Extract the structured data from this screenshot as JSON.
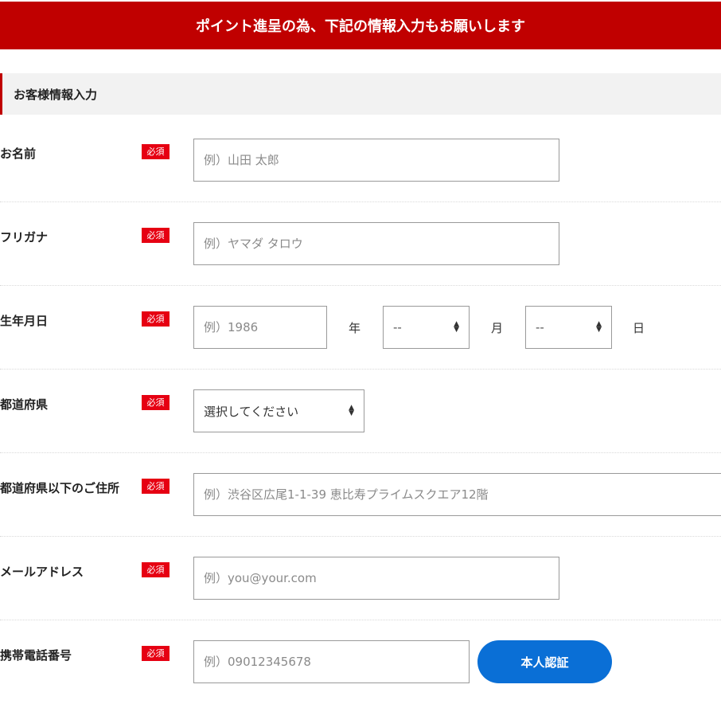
{
  "banner": {
    "text": "ポイント進呈の為、下記の情報入力もお願いします"
  },
  "section": {
    "title": "お客様情報入力"
  },
  "required_label": "必須",
  "fields": {
    "name": {
      "label": "お名前",
      "placeholder": "例）山田 太郎"
    },
    "furigana": {
      "label": "フリガナ",
      "placeholder": "例）ヤマダ タロウ"
    },
    "birthdate": {
      "label": "生年月日",
      "year_placeholder": "例）1986",
      "year_unit": "年",
      "month_value": "--",
      "month_unit": "月",
      "day_value": "--",
      "day_unit": "日"
    },
    "prefecture": {
      "label": "都道府県",
      "value": "選択してください"
    },
    "address": {
      "label": "都道府県以下のご住所",
      "placeholder": "例）渋谷区広尾1-1-39 恵比寿プライムスクエア12階"
    },
    "email": {
      "label": "メールアドレス",
      "placeholder": "例）you@your.com"
    },
    "phone": {
      "label": "携帯電話番号",
      "placeholder": "例）09012345678",
      "verify_button": "本人認証"
    }
  },
  "colors": {
    "brand_red": "#c00000",
    "badge_red": "#e60012",
    "button_blue": "#0a6fd6"
  }
}
